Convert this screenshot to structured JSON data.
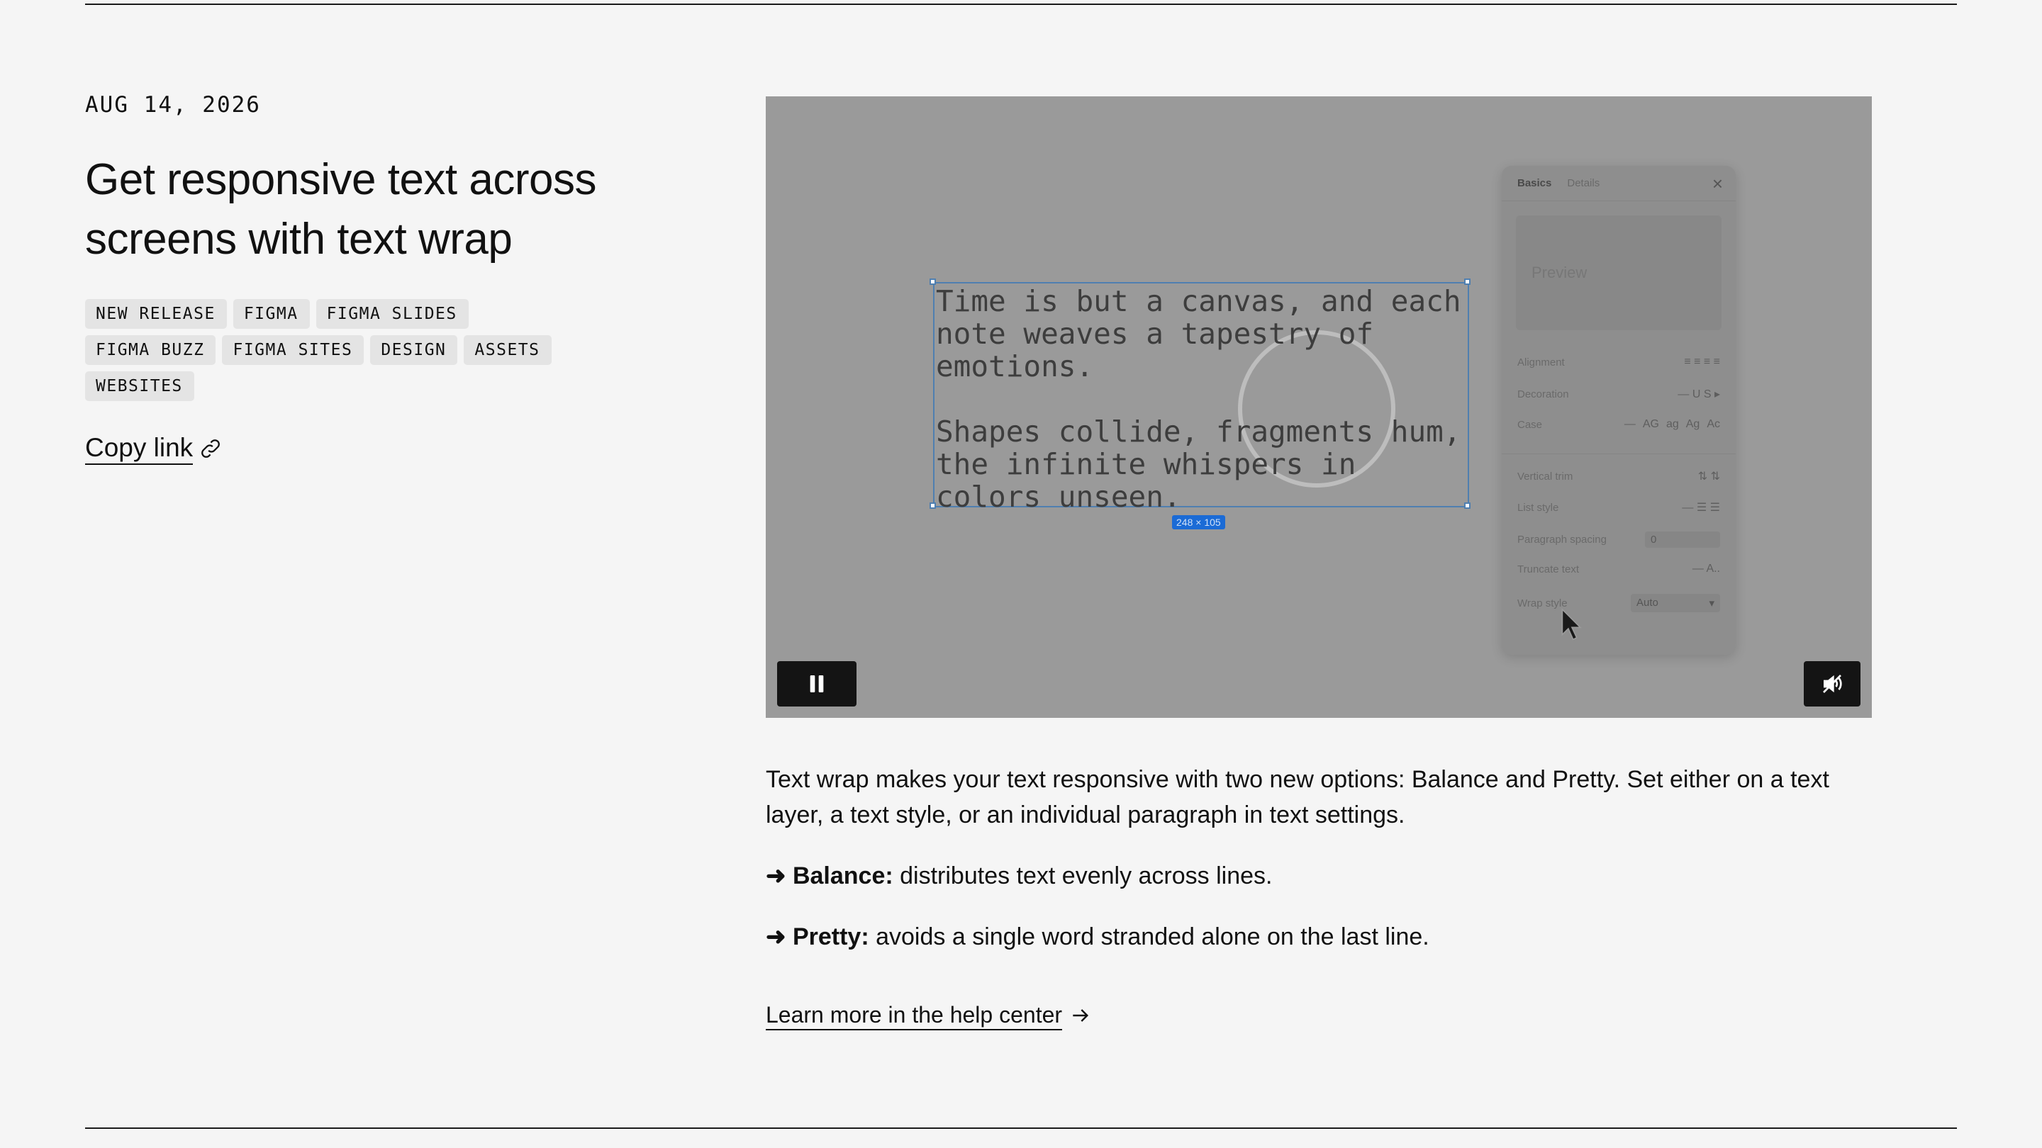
{
  "post": {
    "date": "AUG 14, 2026",
    "title": "Get responsive text across screens with text wrap",
    "tags": [
      "NEW RELEASE",
      "FIGMA",
      "FIGMA SLIDES",
      "FIGMA BUZZ",
      "FIGMA SITES",
      "DESIGN",
      "ASSETS",
      "WEBSITES"
    ],
    "copy_link_label": "Copy link"
  },
  "video": {
    "canvas_text_p1": "Time is but a canvas, and each note weaves a tapestry of emotions.",
    "canvas_text_p2": "Shapes collide, fragments hum, the infinite whispers in colors unseen.",
    "size_badge": "248 × 105",
    "panel": {
      "tab_basics": "Basics",
      "tab_details": "Details",
      "preview_label": "Preview",
      "alignment_label": "Alignment",
      "decoration_label": "Decoration",
      "case_label": "Case",
      "case_options": [
        "AG",
        "ag",
        "Ag",
        "Ac"
      ],
      "vertical_trim_label": "Vertical trim",
      "list_style_label": "List style",
      "paragraph_spacing_label": "Paragraph spacing",
      "paragraph_spacing_value": "0",
      "truncate_text_label": "Truncate text",
      "wrap_style_label": "Wrap style",
      "wrap_style_value": "Auto"
    }
  },
  "content": {
    "intro": "Text wrap makes your text responsive with two new options: Balance and Pretty. Set either on a text layer, a text style, or an individual paragraph in text settings.",
    "balance_label": "Balance:",
    "balance_text": "distributes text evenly across lines.",
    "pretty_label": "Pretty:",
    "pretty_text": "avoids a single word stranded alone on the last line.",
    "arrow": "➜",
    "learn_more": "Learn more in the help center"
  }
}
